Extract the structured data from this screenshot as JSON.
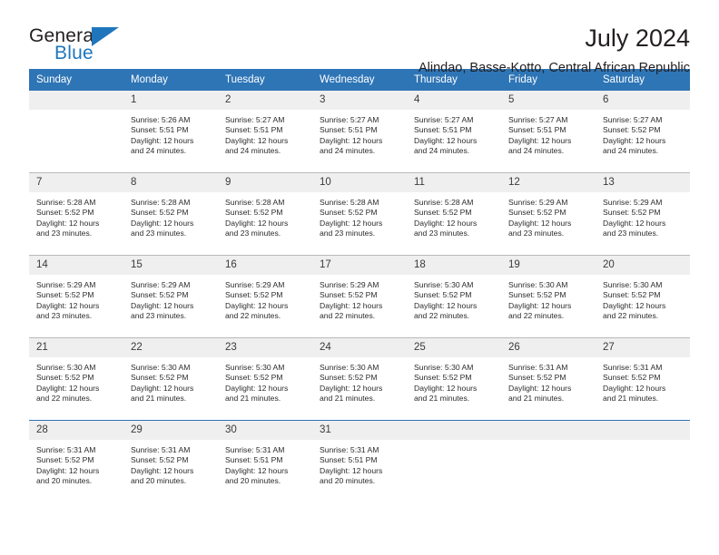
{
  "brand": {
    "name_part1": "General",
    "name_part2": "Blue",
    "accent_color": "#1f76bc"
  },
  "header": {
    "title": "July 2024",
    "subtitle": "Alindao, Basse-Kotto, Central African Republic"
  },
  "theme": {
    "header_blue": "#2e75b6",
    "daynum_band": "#efefef",
    "row_divider": "#b9b9b9"
  },
  "weekday_headers": [
    "Sunday",
    "Monday",
    "Tuesday",
    "Wednesday",
    "Thursday",
    "Friday",
    "Saturday"
  ],
  "labels": {
    "sunrise_prefix": "Sunrise:",
    "sunset_prefix": "Sunset:",
    "daylight_prefix": "Daylight:"
  },
  "weeks": [
    [
      {
        "day": "",
        "sunrise": "",
        "sunset": "",
        "daylight_line1": "",
        "daylight_line2": ""
      },
      {
        "day": "1",
        "sunrise": "Sunrise: 5:26 AM",
        "sunset": "Sunset: 5:51 PM",
        "daylight_line1": "Daylight: 12 hours",
        "daylight_line2": "and 24 minutes."
      },
      {
        "day": "2",
        "sunrise": "Sunrise: 5:27 AM",
        "sunset": "Sunset: 5:51 PM",
        "daylight_line1": "Daylight: 12 hours",
        "daylight_line2": "and 24 minutes."
      },
      {
        "day": "3",
        "sunrise": "Sunrise: 5:27 AM",
        "sunset": "Sunset: 5:51 PM",
        "daylight_line1": "Daylight: 12 hours",
        "daylight_line2": "and 24 minutes."
      },
      {
        "day": "4",
        "sunrise": "Sunrise: 5:27 AM",
        "sunset": "Sunset: 5:51 PM",
        "daylight_line1": "Daylight: 12 hours",
        "daylight_line2": "and 24 minutes."
      },
      {
        "day": "5",
        "sunrise": "Sunrise: 5:27 AM",
        "sunset": "Sunset: 5:51 PM",
        "daylight_line1": "Daylight: 12 hours",
        "daylight_line2": "and 24 minutes."
      },
      {
        "day": "6",
        "sunrise": "Sunrise: 5:27 AM",
        "sunset": "Sunset: 5:52 PM",
        "daylight_line1": "Daylight: 12 hours",
        "daylight_line2": "and 24 minutes."
      }
    ],
    [
      {
        "day": "7",
        "sunrise": "Sunrise: 5:28 AM",
        "sunset": "Sunset: 5:52 PM",
        "daylight_line1": "Daylight: 12 hours",
        "daylight_line2": "and 23 minutes."
      },
      {
        "day": "8",
        "sunrise": "Sunrise: 5:28 AM",
        "sunset": "Sunset: 5:52 PM",
        "daylight_line1": "Daylight: 12 hours",
        "daylight_line2": "and 23 minutes."
      },
      {
        "day": "9",
        "sunrise": "Sunrise: 5:28 AM",
        "sunset": "Sunset: 5:52 PM",
        "daylight_line1": "Daylight: 12 hours",
        "daylight_line2": "and 23 minutes."
      },
      {
        "day": "10",
        "sunrise": "Sunrise: 5:28 AM",
        "sunset": "Sunset: 5:52 PM",
        "daylight_line1": "Daylight: 12 hours",
        "daylight_line2": "and 23 minutes."
      },
      {
        "day": "11",
        "sunrise": "Sunrise: 5:28 AM",
        "sunset": "Sunset: 5:52 PM",
        "daylight_line1": "Daylight: 12 hours",
        "daylight_line2": "and 23 minutes."
      },
      {
        "day": "12",
        "sunrise": "Sunrise: 5:29 AM",
        "sunset": "Sunset: 5:52 PM",
        "daylight_line1": "Daylight: 12 hours",
        "daylight_line2": "and 23 minutes."
      },
      {
        "day": "13",
        "sunrise": "Sunrise: 5:29 AM",
        "sunset": "Sunset: 5:52 PM",
        "daylight_line1": "Daylight: 12 hours",
        "daylight_line2": "and 23 minutes."
      }
    ],
    [
      {
        "day": "14",
        "sunrise": "Sunrise: 5:29 AM",
        "sunset": "Sunset: 5:52 PM",
        "daylight_line1": "Daylight: 12 hours",
        "daylight_line2": "and 23 minutes."
      },
      {
        "day": "15",
        "sunrise": "Sunrise: 5:29 AM",
        "sunset": "Sunset: 5:52 PM",
        "daylight_line1": "Daylight: 12 hours",
        "daylight_line2": "and 23 minutes."
      },
      {
        "day": "16",
        "sunrise": "Sunrise: 5:29 AM",
        "sunset": "Sunset: 5:52 PM",
        "daylight_line1": "Daylight: 12 hours",
        "daylight_line2": "and 22 minutes."
      },
      {
        "day": "17",
        "sunrise": "Sunrise: 5:29 AM",
        "sunset": "Sunset: 5:52 PM",
        "daylight_line1": "Daylight: 12 hours",
        "daylight_line2": "and 22 minutes."
      },
      {
        "day": "18",
        "sunrise": "Sunrise: 5:30 AM",
        "sunset": "Sunset: 5:52 PM",
        "daylight_line1": "Daylight: 12 hours",
        "daylight_line2": "and 22 minutes."
      },
      {
        "day": "19",
        "sunrise": "Sunrise: 5:30 AM",
        "sunset": "Sunset: 5:52 PM",
        "daylight_line1": "Daylight: 12 hours",
        "daylight_line2": "and 22 minutes."
      },
      {
        "day": "20",
        "sunrise": "Sunrise: 5:30 AM",
        "sunset": "Sunset: 5:52 PM",
        "daylight_line1": "Daylight: 12 hours",
        "daylight_line2": "and 22 minutes."
      }
    ],
    [
      {
        "day": "21",
        "sunrise": "Sunrise: 5:30 AM",
        "sunset": "Sunset: 5:52 PM",
        "daylight_line1": "Daylight: 12 hours",
        "daylight_line2": "and 22 minutes."
      },
      {
        "day": "22",
        "sunrise": "Sunrise: 5:30 AM",
        "sunset": "Sunset: 5:52 PM",
        "daylight_line1": "Daylight: 12 hours",
        "daylight_line2": "and 21 minutes."
      },
      {
        "day": "23",
        "sunrise": "Sunrise: 5:30 AM",
        "sunset": "Sunset: 5:52 PM",
        "daylight_line1": "Daylight: 12 hours",
        "daylight_line2": "and 21 minutes."
      },
      {
        "day": "24",
        "sunrise": "Sunrise: 5:30 AM",
        "sunset": "Sunset: 5:52 PM",
        "daylight_line1": "Daylight: 12 hours",
        "daylight_line2": "and 21 minutes."
      },
      {
        "day": "25",
        "sunrise": "Sunrise: 5:30 AM",
        "sunset": "Sunset: 5:52 PM",
        "daylight_line1": "Daylight: 12 hours",
        "daylight_line2": "and 21 minutes."
      },
      {
        "day": "26",
        "sunrise": "Sunrise: 5:31 AM",
        "sunset": "Sunset: 5:52 PM",
        "daylight_line1": "Daylight: 12 hours",
        "daylight_line2": "and 21 minutes."
      },
      {
        "day": "27",
        "sunrise": "Sunrise: 5:31 AM",
        "sunset": "Sunset: 5:52 PM",
        "daylight_line1": "Daylight: 12 hours",
        "daylight_line2": "and 21 minutes."
      }
    ],
    [
      {
        "day": "28",
        "sunrise": "Sunrise: 5:31 AM",
        "sunset": "Sunset: 5:52 PM",
        "daylight_line1": "Daylight: 12 hours",
        "daylight_line2": "and 20 minutes."
      },
      {
        "day": "29",
        "sunrise": "Sunrise: 5:31 AM",
        "sunset": "Sunset: 5:52 PM",
        "daylight_line1": "Daylight: 12 hours",
        "daylight_line2": "and 20 minutes."
      },
      {
        "day": "30",
        "sunrise": "Sunrise: 5:31 AM",
        "sunset": "Sunset: 5:51 PM",
        "daylight_line1": "Daylight: 12 hours",
        "daylight_line2": "and 20 minutes."
      },
      {
        "day": "31",
        "sunrise": "Sunrise: 5:31 AM",
        "sunset": "Sunset: 5:51 PM",
        "daylight_line1": "Daylight: 12 hours",
        "daylight_line2": "and 20 minutes."
      },
      {
        "day": "",
        "sunrise": "",
        "sunset": "",
        "daylight_line1": "",
        "daylight_line2": ""
      },
      {
        "day": "",
        "sunrise": "",
        "sunset": "",
        "daylight_line1": "",
        "daylight_line2": ""
      },
      {
        "day": "",
        "sunrise": "",
        "sunset": "",
        "daylight_line1": "",
        "daylight_line2": ""
      }
    ]
  ]
}
